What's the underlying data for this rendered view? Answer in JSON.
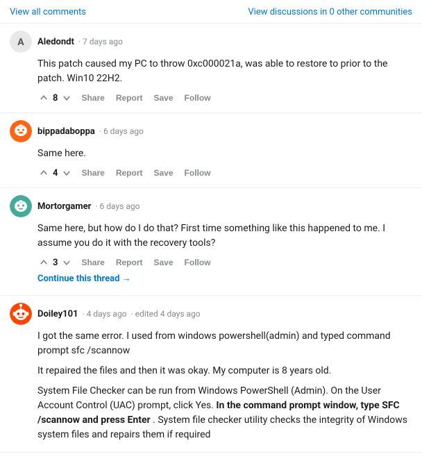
{
  "header": {
    "view_all_comments": "View all comments",
    "view_discussions": "View discussions in 0 other communities"
  },
  "comments": [
    {
      "id": "comment-1",
      "username": "Aledondt",
      "timestamp": "7 days ago",
      "edited": "",
      "body": [
        "This patch caused my PC to throw 0xc000021a, was able to restore to prior to the patch. Win10 22H2."
      ],
      "vote_count": "8",
      "actions": [
        "Share",
        "Report",
        "Save",
        "Follow"
      ],
      "has_continue": false,
      "avatar_type": "letter",
      "avatar_letter": "A"
    },
    {
      "id": "comment-2",
      "username": "bippadaboppa",
      "timestamp": "6 days ago",
      "edited": "",
      "body": [
        "Same here."
      ],
      "vote_count": "4",
      "actions": [
        "Share",
        "Report",
        "Save",
        "Follow"
      ],
      "has_continue": false,
      "avatar_type": "snoo",
      "avatar_color": "#ff6314"
    },
    {
      "id": "comment-3",
      "username": "Mortorgamer",
      "timestamp": "6 days ago",
      "edited": "",
      "body": [
        "Same here, but how do I do that? First time something like this happened to me. I assume you do it with the recovery tools?"
      ],
      "vote_count": "3",
      "actions": [
        "Share",
        "Report",
        "Save",
        "Follow"
      ],
      "has_continue": true,
      "continue_text": "Continue this thread →",
      "avatar_type": "snoo2",
      "avatar_color": "#46d160"
    },
    {
      "id": "comment-4",
      "username": "Doiley101",
      "timestamp": "4 days ago",
      "edited": "edited 4 days ago",
      "body_parts": [
        {
          "text": "I got the same error. I used from windows powershell(admin) and typed command prompt sfc /scannow",
          "bold": false
        },
        {
          "text": "It repaired the files and then it was okay. My computer is 8 years old.",
          "bold": false
        },
        {
          "text": "System File Checker can be run from Windows PowerShell (Admin). On the User Account Control (UAC) prompt, click Yes. ",
          "bold": false,
          "has_bold_inline": true,
          "bold_part": "In the command prompt window, type SFC /scannow and press Enter",
          "after_bold": " . System file checker utility checks the integrity of Windows system files and repairs them if required",
          "bold_before": "System File Checker can be run from Windows PowerShell (Admin). On the User Account Control (UAC) prompt, click Yes. "
        }
      ],
      "vote_count": "",
      "actions": [],
      "has_continue": false,
      "avatar_type": "reddit-circle",
      "avatar_color": "#ff4500"
    }
  ],
  "actions": {
    "share": "Share",
    "report": "Report",
    "save": "Save",
    "follow": "Follow"
  }
}
